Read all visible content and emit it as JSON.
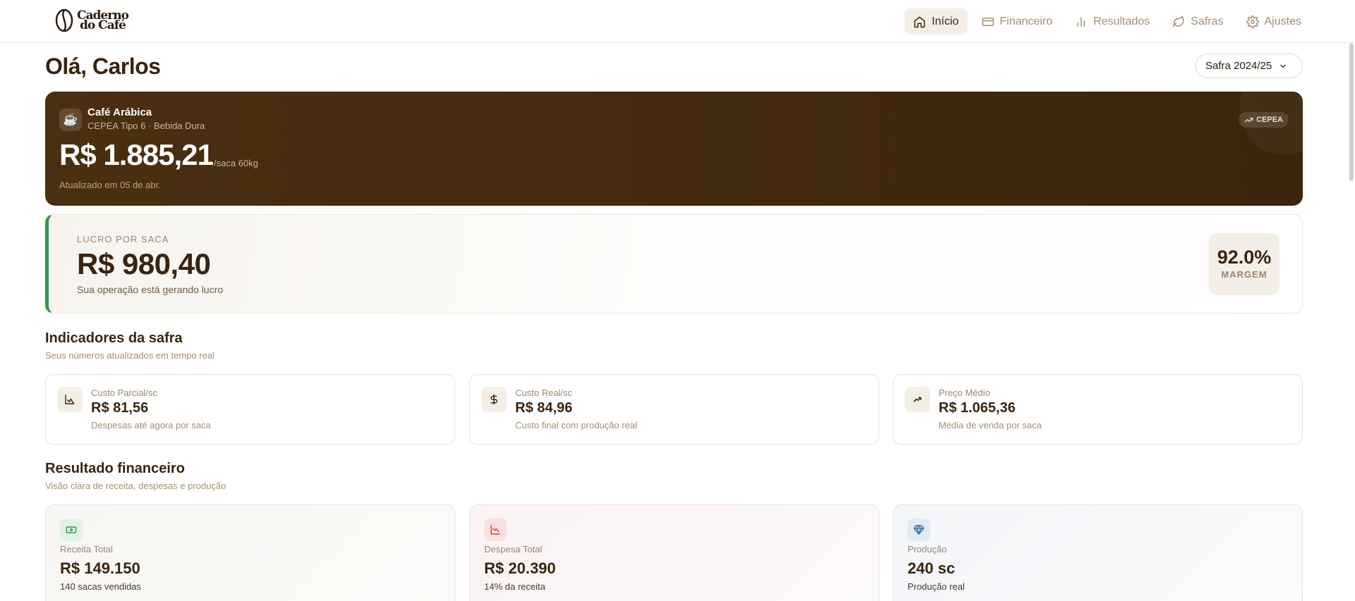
{
  "brand": {
    "name_line1": "Caderno",
    "name_line2": "do Café"
  },
  "nav": [
    {
      "label": "Início",
      "icon": "home-icon",
      "active": true
    },
    {
      "label": "Financeiro",
      "icon": "card-icon",
      "active": false
    },
    {
      "label": "Resultados",
      "icon": "bar-chart-icon",
      "active": false
    },
    {
      "label": "Safras",
      "icon": "leaf-icon",
      "active": false
    },
    {
      "label": "Ajustes",
      "icon": "gear-icon",
      "active": false
    }
  ],
  "greeting": "Olá, Carlos",
  "safra_select": {
    "value": "Safra 2024/25"
  },
  "price_card": {
    "icon": "coffee-cup-icon",
    "name": "Café Arábica",
    "subtitle": "CEPEA Tipo 6 · Bebida Dura",
    "badge": "CEPEA",
    "price": "R$ 1.885,21",
    "unit": "/saca 60kg",
    "updated": "Atualizado em 05 de abr."
  },
  "lucro_card": {
    "label": "LUCRO POR SACA",
    "value": "R$ 980,40",
    "subtitle": "Sua operação está gerando lucro",
    "margem_value": "92.0%",
    "margem_label": "MARGEM"
  },
  "indicadores": {
    "title": "Indicadores da safra",
    "subtitle": "Seus números atualizados em tempo real",
    "cards": [
      {
        "icon": "line-chart-icon",
        "label": "Custo Parcial/sc",
        "value": "R$ 81,56",
        "sub": "Despesas até agora por saca"
      },
      {
        "icon": "dollar-icon",
        "label": "Custo Real/sc",
        "value": "R$ 84,96",
        "sub": "Custo final com produção real"
      },
      {
        "icon": "trend-up-icon",
        "label": "Preço Médio",
        "value": "R$ 1.065,36",
        "sub": "Média de venda por saca"
      }
    ]
  },
  "resultado": {
    "title": "Resultado financeiro",
    "subtitle": "Visão clara de receita, despesas e produção",
    "cards": [
      {
        "icon": "banknote-icon",
        "label": "Receita Total",
        "value": "R$ 149.150",
        "sub": "140 sacas vendidas",
        "accent": "#2e9a4a"
      },
      {
        "icon": "chart-down-icon",
        "label": "Despesa Total",
        "value": "R$ 20.390",
        "sub": "14% da receita",
        "accent": "#d04848"
      },
      {
        "icon": "diamond-icon",
        "label": "Produção",
        "value": "240 sc",
        "sub": "Produção real",
        "accent": "#3a6ea8"
      }
    ]
  },
  "colors": {
    "brown_dark": "#3a2510",
    "profit_green": "#2e9a4a",
    "muted": "#a58e72"
  }
}
